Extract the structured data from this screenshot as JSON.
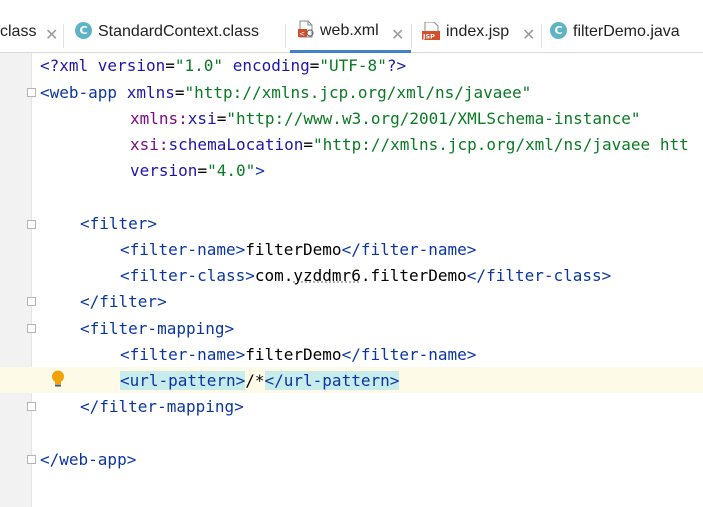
{
  "tabs": [
    {
      "label": "class",
      "icon": "none"
    },
    {
      "label": "StandardContext.class",
      "icon": "class-c-icon"
    },
    {
      "label": "web.xml",
      "icon": "xml-file-icon",
      "active": true
    },
    {
      "label": "index.jsp",
      "icon": "jsp-file-icon"
    },
    {
      "label": "filterDemo.java",
      "icon": "class-c-icon"
    }
  ],
  "close_glyph": "✕",
  "c_icon_letter": "C",
  "code": {
    "l1": {
      "a": "<?xml ",
      "b": "version",
      "c": "=",
      "d": "\"1.0\"",
      "e": " ",
      "f": "encoding",
      "g": "=",
      "h": "\"UTF-8\"",
      "i": "?>"
    },
    "l2": {
      "a": "<web-app ",
      "b": "xmlns",
      "c": "=",
      "d": "\"http://xmlns.jcp.org/xml/ns/javaee\""
    },
    "l3": {
      "a": "xmlns:",
      "b": "xsi",
      "c": "=",
      "d": "\"http://www.w3.org/2001/XMLSchema-instance\""
    },
    "l4": {
      "a": "xsi:",
      "b": "schemaLocation",
      "c": "=",
      "d": "\"http://xmlns.jcp.org/xml/ns/javaee htt"
    },
    "l5": {
      "a": "version",
      "b": "=",
      "c": "\"4.0\"",
      "d": ">"
    },
    "l7": {
      "a": "<filter>"
    },
    "l8": {
      "a": "<filter-name>",
      "b": "filterDemo",
      "c": "</filter-name>"
    },
    "l9": {
      "a": "<filter-class>",
      "b": "com.",
      "c": "yzddmr6",
      "d": ".filterDemo",
      "e": "</filter-class>"
    },
    "l10": {
      "a": "</filter>"
    },
    "l11": {
      "a": "<filter-mapping>"
    },
    "l12": {
      "a": "<filter-name>",
      "b": "filterDemo",
      "c": "</filter-name>"
    },
    "l13": {
      "a": "<url-pattern>",
      "b": "/*",
      "c": "</url-pattern>"
    },
    "l14": {
      "a": "</filter-mapping>"
    },
    "l16": {
      "a": "</web-app>"
    }
  }
}
